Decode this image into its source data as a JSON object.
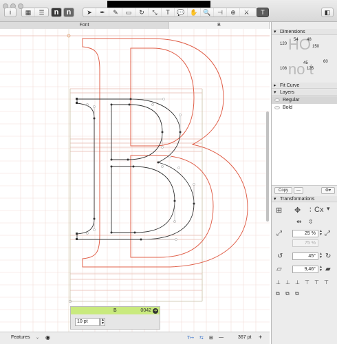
{
  "window": {
    "title": ""
  },
  "toolbar": {
    "info_label": "i",
    "n1_label": "n",
    "n2_label": "n",
    "icons": [
      "pointer-icon",
      "pen-icon",
      "draw-icon",
      "rectangle-icon",
      "rotate-icon",
      "scale-icon",
      "text-icon",
      "comment-icon",
      "hand-icon",
      "zoom-icon",
      "measure-icon",
      "globe-icon",
      "knife-icon",
      "type-icon"
    ]
  },
  "tabs": [
    {
      "label": "Font"
    },
    {
      "label": "B"
    }
  ],
  "glyph_box": {
    "glyph": "B",
    "unicode": "0042",
    "size_value": "10 pt"
  },
  "status": {
    "features_label": "Features",
    "zoom": "367 pt"
  },
  "sidebar": {
    "dimensions_label": "Dimensions",
    "metrics": {
      "a": "120",
      "b": "54",
      "c": "48",
      "d": "150",
      "e": "108",
      "f": "45",
      "g": "126",
      "h": "60"
    },
    "fit_curve_label": "Fit Curve",
    "layers_label": "Layers",
    "layers": [
      {
        "name": "Regular"
      },
      {
        "name": "Bold"
      }
    ],
    "copy_label": "Copy",
    "transformations_label": "Transformations",
    "scale_value": "25 %",
    "scale_value_disabled": "75 %",
    "rotate_value": "45°",
    "slant_value": "9,46°",
    "align_glyph": "Cx"
  },
  "colors": {
    "toolbar_bg": "#dcdcdc",
    "glyph_box_header": "#c9ea7e",
    "outline_red": "#e0604a",
    "grid": "#f0d6cf"
  }
}
